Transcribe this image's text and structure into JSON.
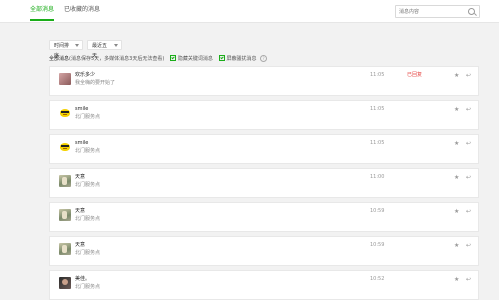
{
  "tabs": [
    {
      "label": "全部消息",
      "active": true
    },
    {
      "label": "已收藏的消息",
      "active": false
    }
  ],
  "search": {
    "placeholder": "消息内容"
  },
  "filters": {
    "sort": "时间排序",
    "range": "最近五天"
  },
  "summary": {
    "title": "全部消息",
    "note": "(消息保存5天，多媒体消息3天后无法查看)",
    "hide_keyword": "隐藏关键词消息",
    "block_harass": "屏蔽骚扰消息",
    "help_icon": "?"
  },
  "icons": {
    "star": "★",
    "reply": "↩"
  },
  "colors": {
    "accent": "#1aad19",
    "status_red": "#e64340"
  },
  "messages": [
    {
      "name": "欢乐多少",
      "text": "我全嗨的要开始了",
      "time": "11:05",
      "status": "已回复",
      "avatar": "pink-flower"
    },
    {
      "name": "smile",
      "text": "北门服务点",
      "time": "11:05",
      "status": "",
      "avatar": "smile-emoji"
    },
    {
      "name": "smile",
      "text": "北门服务点",
      "time": "11:05",
      "status": "",
      "avatar": "smile-emoji"
    },
    {
      "name": "天意",
      "text": "北门服务点",
      "time": "11:00",
      "status": "",
      "avatar": "landscape"
    },
    {
      "name": "天意",
      "text": "北门服务点",
      "time": "10:59",
      "status": "",
      "avatar": "landscape"
    },
    {
      "name": "天意",
      "text": "北门服务点",
      "time": "10:59",
      "status": "",
      "avatar": "landscape"
    },
    {
      "name": "美佳。",
      "text": "北门服务点",
      "time": "10:52",
      "status": "",
      "avatar": "portrait"
    }
  ]
}
